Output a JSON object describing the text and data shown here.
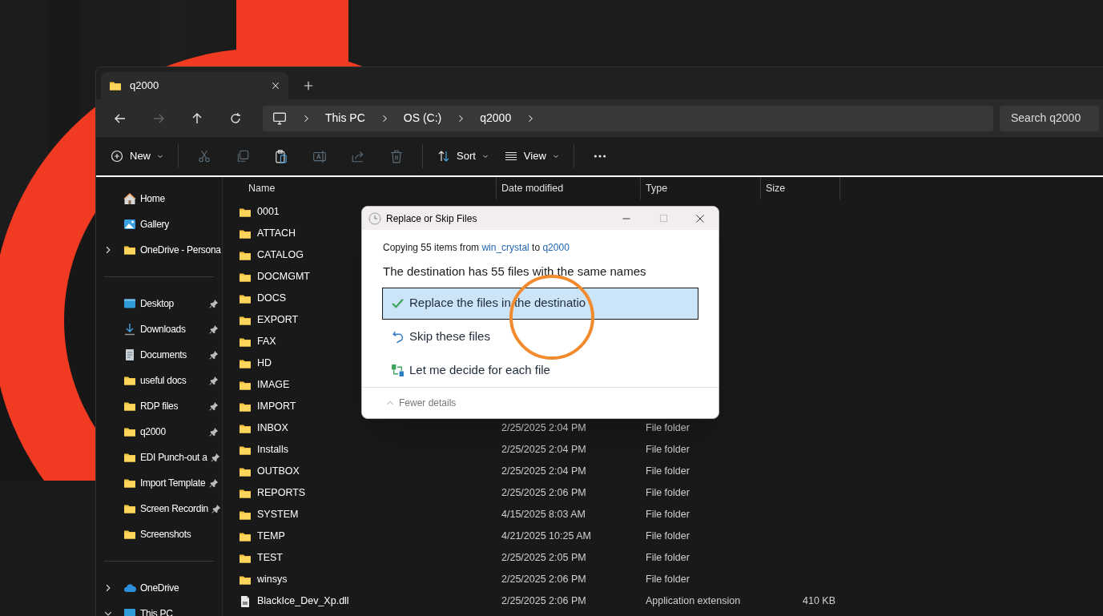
{
  "background": {
    "kind": "picture"
  },
  "tabs": [
    {
      "label": "q2000",
      "selected": true
    }
  ],
  "nav": [
    {
      "kind": "back",
      "disabled": false
    },
    {
      "kind": "forward",
      "disabled": true
    },
    {
      "kind": "up",
      "disabled": false
    },
    {
      "kind": "refresh",
      "disabled": false
    }
  ],
  "breadcrumb": [
    "This PC",
    "OS (C:)",
    "q2000"
  ],
  "search": {
    "placeholder": "Search q2000"
  },
  "toolbar": [
    {
      "kind": "new",
      "label": "New",
      "disabled": false
    },
    {
      "kind": "cut",
      "disabled": true
    },
    {
      "kind": "copy",
      "disabled": true
    },
    {
      "kind": "paste",
      "disabled": false
    },
    {
      "kind": "rename",
      "disabled": true
    },
    {
      "kind": "share",
      "disabled": true
    },
    {
      "kind": "delete",
      "disabled": true
    },
    {
      "kind": "sort",
      "label": "Sort",
      "disabled": false
    },
    {
      "kind": "view",
      "label": "View",
      "disabled": false
    },
    {
      "kind": "more",
      "disabled": false
    }
  ],
  "sidebar": {
    "sections": [
      [
        {
          "kind": "home",
          "label": "Home",
          "pinned": false
        },
        {
          "kind": "gallery",
          "label": "Gallery",
          "pinned": false
        },
        {
          "kind": "folder",
          "label": "OneDrive - Persona",
          "pinned": false,
          "expanded": false
        }
      ],
      [
        {
          "kind": "desktop",
          "label": "Desktop",
          "pinned": true
        },
        {
          "kind": "download",
          "label": "Downloads",
          "pinned": true
        },
        {
          "kind": "document",
          "label": "Documents",
          "pinned": true
        },
        {
          "kind": "folder",
          "label": "useful docs",
          "pinned": true
        },
        {
          "kind": "folder",
          "label": "RDP files",
          "pinned": true
        },
        {
          "kind": "folder",
          "label": "q2000",
          "pinned": true
        },
        {
          "kind": "folder",
          "label": "EDI Punch-out a",
          "pinned": true
        },
        {
          "kind": "folder",
          "label": "Import Template",
          "pinned": true
        },
        {
          "kind": "folder",
          "label": "Screen Recordin",
          "pinned": true
        },
        {
          "kind": "folder",
          "label": "Screenshots",
          "pinned": false
        }
      ],
      [
        {
          "kind": "cloud",
          "label": "OneDrive",
          "pinned": false,
          "expanded": false
        },
        {
          "kind": "pc",
          "label": "This PC",
          "pinned": false,
          "expanded": true
        }
      ]
    ]
  },
  "table": {
    "columns": [
      "Name",
      "Date modified",
      "Type",
      "Size"
    ],
    "rows": [
      {
        "kind": "folder",
        "name": "0001"
      },
      {
        "kind": "folder",
        "name": "ATTACH"
      },
      {
        "kind": "folder",
        "name": "CATALOG"
      },
      {
        "kind": "folder",
        "name": "DOCMGMT"
      },
      {
        "kind": "folder",
        "name": "DOCS"
      },
      {
        "kind": "folder",
        "name": "EXPORT"
      },
      {
        "kind": "folder",
        "name": "FAX"
      },
      {
        "kind": "folder",
        "name": "HD"
      },
      {
        "kind": "folder",
        "name": "IMAGE"
      },
      {
        "kind": "folder",
        "name": "IMPORT"
      },
      {
        "kind": "folder",
        "name": "INBOX",
        "date": "2/25/2025 2:04 PM",
        "type": "File folder"
      },
      {
        "kind": "folder",
        "name": "Installs",
        "date": "2/25/2025 2:04 PM",
        "type": "File folder"
      },
      {
        "kind": "folder",
        "name": "OUTBOX",
        "date": "2/25/2025 2:04 PM",
        "type": "File folder"
      },
      {
        "kind": "folder",
        "name": "REPORTS",
        "date": "2/25/2025 2:06 PM",
        "type": "File folder"
      },
      {
        "kind": "folder",
        "name": "SYSTEM",
        "date": "4/15/2025 8:03 AM",
        "type": "File folder"
      },
      {
        "kind": "folder",
        "name": "TEMP",
        "date": "4/21/2025 10:25 AM",
        "type": "File folder"
      },
      {
        "kind": "folder",
        "name": "TEST",
        "date": "2/25/2025 2:05 PM",
        "type": "File folder"
      },
      {
        "kind": "folder",
        "name": "winsys",
        "date": "2/25/2025 2:06 PM",
        "type": "File folder"
      },
      {
        "kind": "file",
        "name": "BlackIce_Dev_Xp.dll",
        "date": "2/25/2025 2:06 PM",
        "type": "Application extension",
        "size": "410 KB"
      }
    ]
  },
  "dialog": {
    "title": "Replace or Skip Files",
    "summary": [
      {
        "kind": "text",
        "text": "Copying 55 items from "
      },
      {
        "kind": "link",
        "text": "win_crystal"
      },
      {
        "kind": "text",
        "text": " to "
      },
      {
        "kind": "link",
        "text": "q2000"
      }
    ],
    "heading": "The destination has 55 files with the same names",
    "options": [
      {
        "kind": "replace",
        "label": "Replace the files in the destinatio",
        "selected": true
      },
      {
        "kind": "skip",
        "label": "Skip these files",
        "selected": false
      },
      {
        "kind": "decide",
        "label": "Let me decide for each file",
        "selected": false
      }
    ],
    "details": {
      "label": "Fewer details",
      "expanded": true
    }
  }
}
